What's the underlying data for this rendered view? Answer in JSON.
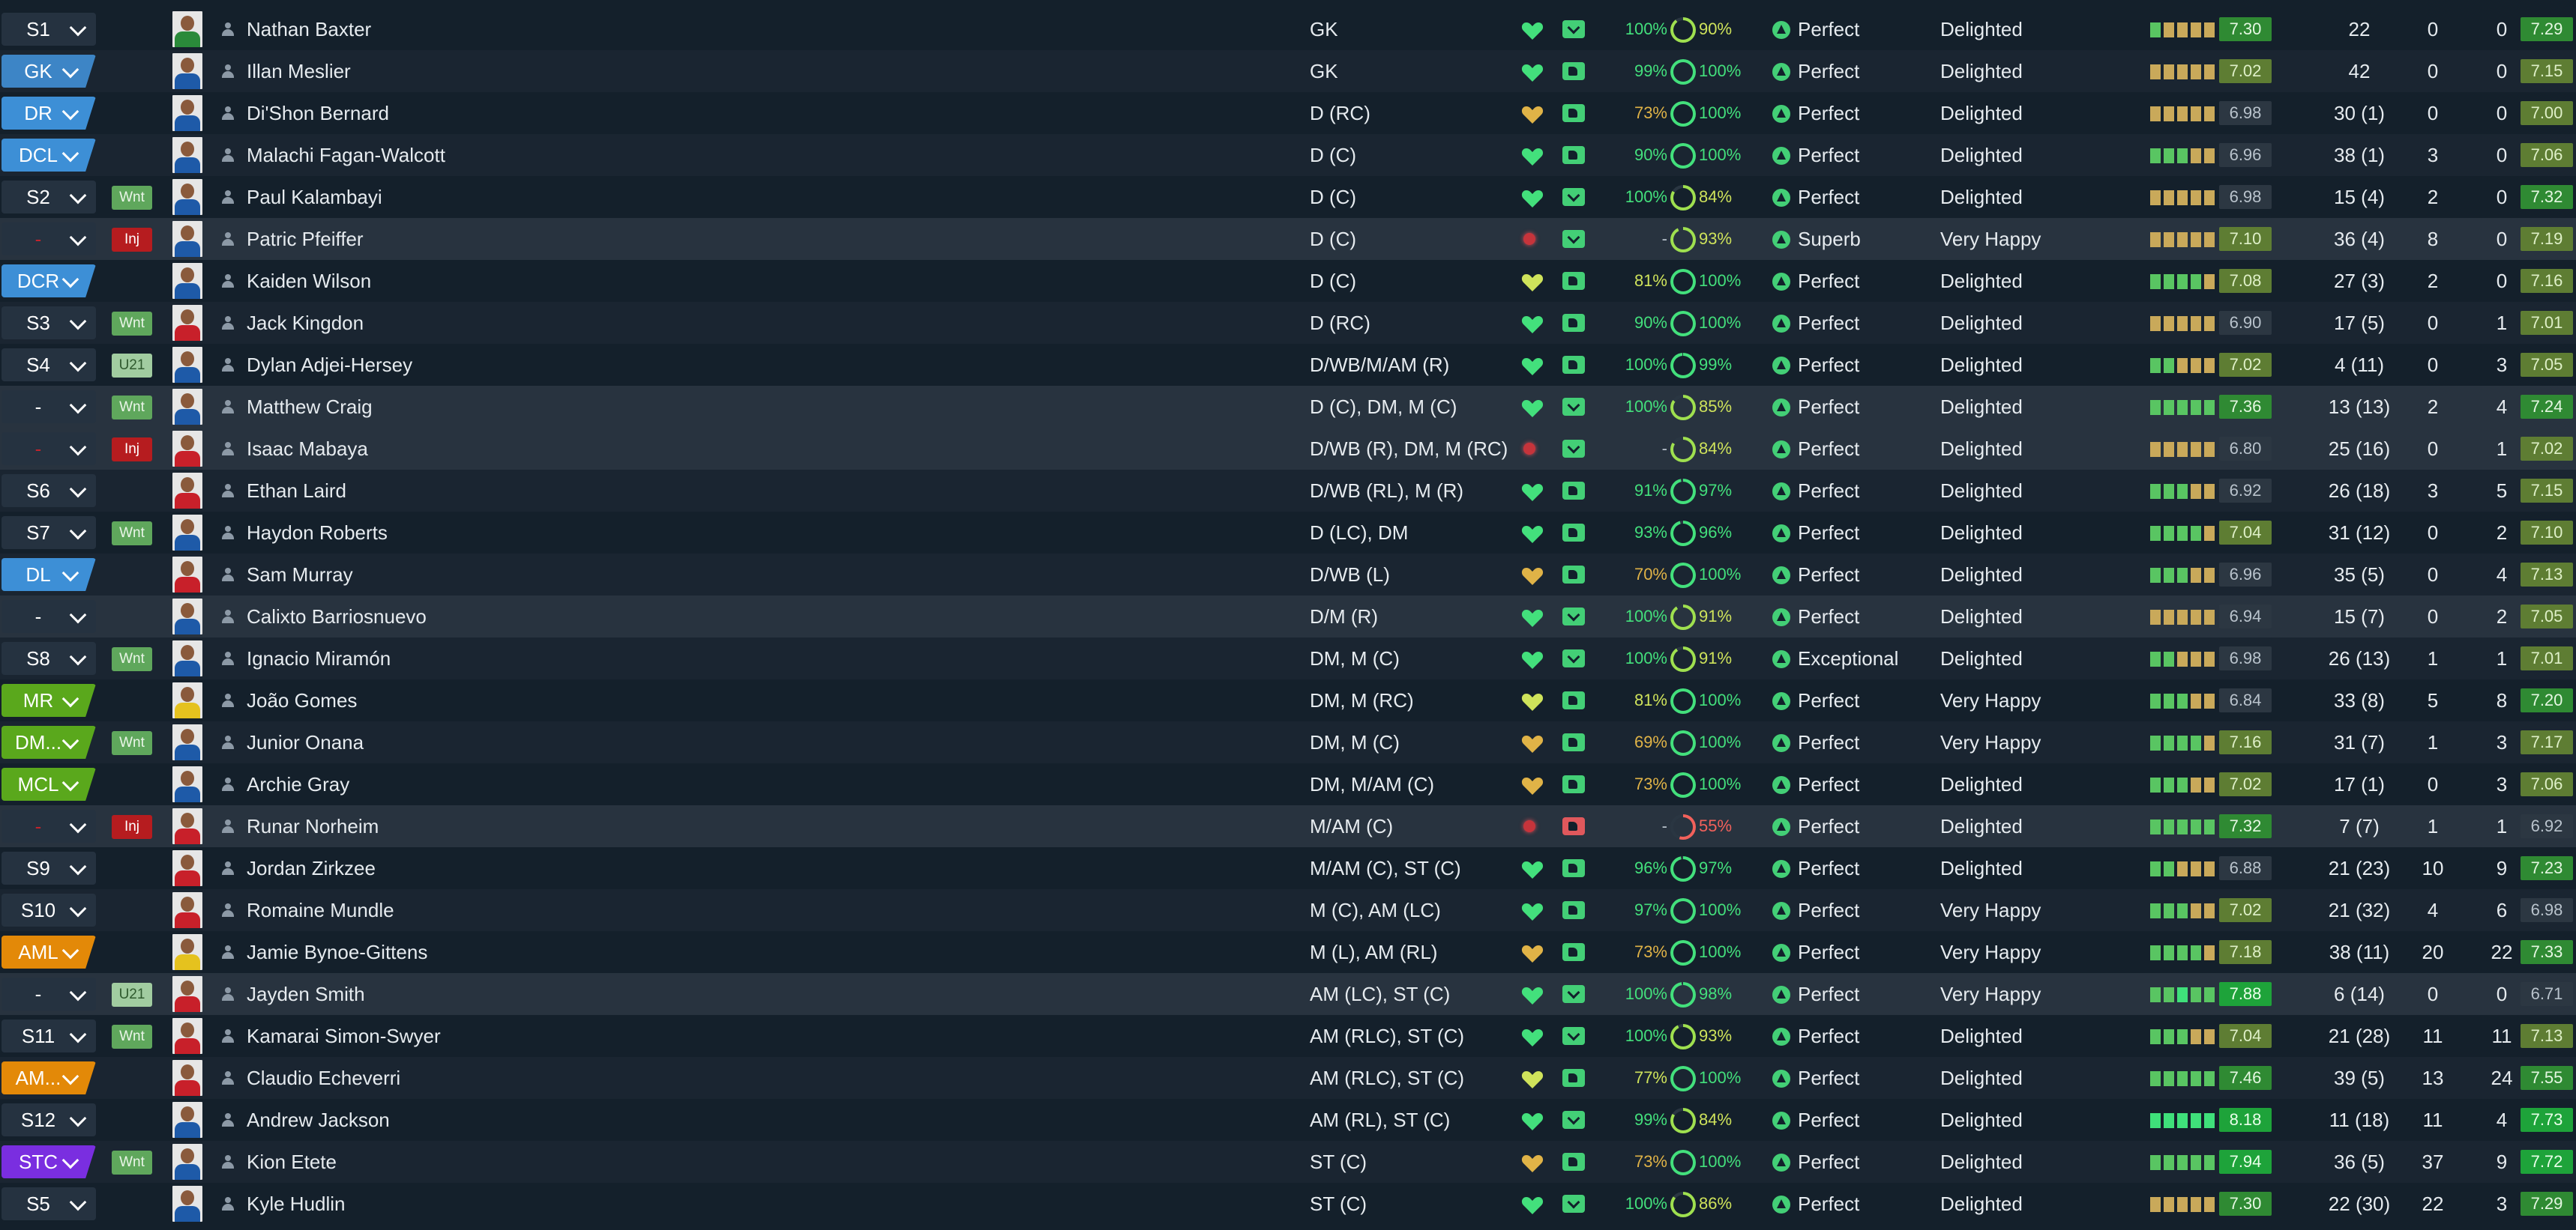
{
  "colors": {
    "pos_gk": "#3d85c6",
    "pos_def": "#3d8fd6",
    "pos_mid": "#5aa81c",
    "pos_att": "#e38908",
    "pos_st": "#7a2ee0",
    "good": "#43e07c",
    "caution": "#e0b347",
    "injury": "#c0242d"
  },
  "players": [
    {
      "sel": "S1",
      "sel_style": "plain",
      "tag": "",
      "tag_style": "",
      "kit": "green",
      "name": "Nathan Baxter",
      "position": "GK",
      "heart": "green",
      "fit": "check",
      "condition": "100%",
      "sharpness": "90%",
      "sharp_pct": 90,
      "morale_label": "Perfect",
      "happiness": "Delighted",
      "form": [
        3,
        2,
        2,
        2,
        2
      ],
      "rating": "7.30",
      "apps": "22",
      "goals": "0",
      "assists": "0",
      "avg": "7.29"
    },
    {
      "sel": "GK",
      "sel_style": "gk",
      "tag": "",
      "tag_style": "",
      "kit": "blue",
      "name": "Illan Meslier",
      "position": "GK",
      "heart": "green",
      "fit": "thumb",
      "condition": "99%",
      "sharpness": "100%",
      "sharp_pct": 100,
      "morale_label": "Perfect",
      "happiness": "Delighted",
      "form": [
        2,
        2,
        2,
        2,
        2
      ],
      "rating": "7.02",
      "apps": "42",
      "goals": "0",
      "assists": "0",
      "avg": "7.15"
    },
    {
      "sel": "DR",
      "sel_style": "def",
      "tag": "",
      "tag_style": "",
      "kit": "blue",
      "name": "Di'Shon Bernard",
      "position": "D (RC)",
      "heart": "amber",
      "fit": "thumb",
      "condition": "73%",
      "sharpness": "100%",
      "sharp_pct": 100,
      "morale_label": "Perfect",
      "happiness": "Delighted",
      "form": [
        2,
        2,
        2,
        2,
        2
      ],
      "rating": "6.98",
      "apps": "30 (1)",
      "goals": "0",
      "assists": "0",
      "avg": "7.00"
    },
    {
      "sel": "DCL",
      "sel_style": "def",
      "tag": "",
      "tag_style": "",
      "kit": "blue",
      "name": "Malachi Fagan-Walcott",
      "position": "D (C)",
      "heart": "green",
      "fit": "thumb",
      "condition": "90%",
      "sharpness": "100%",
      "sharp_pct": 100,
      "morale_label": "Perfect",
      "happiness": "Delighted",
      "form": [
        3,
        3,
        3,
        2,
        2
      ],
      "rating": "6.96",
      "apps": "38 (1)",
      "goals": "3",
      "assists": "0",
      "avg": "7.06"
    },
    {
      "sel": "S2",
      "sel_style": "plain",
      "tag": "Wnt",
      "tag_style": "wnt",
      "kit": "blue",
      "name": "Paul Kalambayi",
      "position": "D (C)",
      "heart": "green",
      "fit": "check",
      "condition": "100%",
      "sharpness": "84%",
      "sharp_pct": 84,
      "morale_label": "Perfect",
      "happiness": "Delighted",
      "form": [
        2,
        2,
        2,
        2,
        2
      ],
      "rating": "6.98",
      "apps": "15 (4)",
      "goals": "2",
      "assists": "0",
      "avg": "7.32"
    },
    {
      "sel": "-",
      "sel_style": "plain inj",
      "tag": "Inj",
      "tag_style": "inj",
      "kit": "blue",
      "name": "Patric Pfeiffer",
      "position": "D (C)",
      "heart": "injury",
      "fit": "check",
      "condition": "-",
      "sharpness": "93%",
      "sharp_pct": 93,
      "morale_label": "Superb",
      "happiness": "Very Happy",
      "form": [
        2,
        2,
        2,
        2,
        2
      ],
      "rating": "7.10",
      "apps": "36 (4)",
      "goals": "8",
      "assists": "0",
      "avg": "7.19"
    },
    {
      "sel": "DCR",
      "sel_style": "def",
      "tag": "",
      "tag_style": "",
      "kit": "blue",
      "name": "Kaiden Wilson",
      "position": "D (C)",
      "heart": "yellow",
      "fit": "thumb",
      "condition": "81%",
      "sharpness": "100%",
      "sharp_pct": 100,
      "morale_label": "Perfect",
      "happiness": "Delighted",
      "form": [
        3,
        3,
        3,
        3,
        2
      ],
      "rating": "7.08",
      "apps": "27 (3)",
      "goals": "2",
      "assists": "0",
      "avg": "7.16"
    },
    {
      "sel": "S3",
      "sel_style": "plain",
      "tag": "Wnt",
      "tag_style": "wnt",
      "kit": "red",
      "name": "Jack Kingdon",
      "position": "D (RC)",
      "heart": "green",
      "fit": "thumb",
      "condition": "90%",
      "sharpness": "100%",
      "sharp_pct": 100,
      "morale_label": "Perfect",
      "happiness": "Delighted",
      "form": [
        2,
        2,
        2,
        2,
        2
      ],
      "rating": "6.90",
      "apps": "17 (5)",
      "goals": "0",
      "assists": "1",
      "avg": "7.01"
    },
    {
      "sel": "S4",
      "sel_style": "plain",
      "tag": "U21",
      "tag_style": "u21",
      "kit": "blue",
      "name": "Dylan Adjei-Hersey",
      "position": "D/WB/M/AM (R)",
      "heart": "green",
      "fit": "thumb",
      "condition": "100%",
      "sharpness": "99%",
      "sharp_pct": 99,
      "morale_label": "Perfect",
      "happiness": "Delighted",
      "form": [
        3,
        3,
        2,
        2,
        2
      ],
      "rating": "7.02",
      "apps": "4 (11)",
      "goals": "0",
      "assists": "3",
      "avg": "7.05"
    },
    {
      "sel": "-",
      "sel_style": "plain",
      "tag": "Wnt",
      "tag_style": "wnt",
      "kit": "blue",
      "name": "Matthew Craig",
      "position": "D (C), DM, M (C)",
      "heart": "green",
      "fit": "check",
      "condition": "100%",
      "sharpness": "85%",
      "sharp_pct": 85,
      "morale_label": "Perfect",
      "happiness": "Delighted",
      "form": [
        3,
        3,
        3,
        3,
        3
      ],
      "rating": "7.36",
      "apps": "13 (13)",
      "goals": "2",
      "assists": "4",
      "avg": "7.24"
    },
    {
      "sel": "-",
      "sel_style": "plain inj",
      "tag": "Inj",
      "tag_style": "inj",
      "kit": "red",
      "name": "Isaac Mabaya",
      "position": "D/WB (R), DM, M (RC)",
      "heart": "injury",
      "fit": "check",
      "condition": "-",
      "sharpness": "84%",
      "sharp_pct": 84,
      "morale_label": "Perfect",
      "happiness": "Delighted",
      "form": [
        2,
        2,
        2,
        2,
        2
      ],
      "rating": "6.80",
      "apps": "25 (16)",
      "goals": "0",
      "assists": "1",
      "avg": "7.02"
    },
    {
      "sel": "S6",
      "sel_style": "plain",
      "tag": "",
      "tag_style": "",
      "kit": "red",
      "name": "Ethan Laird",
      "position": "D/WB (RL), M (R)",
      "heart": "green",
      "fit": "thumb",
      "condition": "91%",
      "sharpness": "97%",
      "sharp_pct": 97,
      "morale_label": "Perfect",
      "happiness": "Delighted",
      "form": [
        3,
        3,
        3,
        2,
        2
      ],
      "rating": "6.92",
      "apps": "26 (18)",
      "goals": "3",
      "assists": "5",
      "avg": "7.15"
    },
    {
      "sel": "S7",
      "sel_style": "plain",
      "tag": "Wnt",
      "tag_style": "wnt",
      "kit": "blue",
      "name": "Haydon Roberts",
      "position": "D (LC), DM",
      "heart": "green",
      "fit": "thumb",
      "condition": "93%",
      "sharpness": "96%",
      "sharp_pct": 96,
      "morale_label": "Perfect",
      "happiness": "Delighted",
      "form": [
        3,
        3,
        3,
        3,
        2
      ],
      "rating": "7.04",
      "apps": "31 (12)",
      "goals": "0",
      "assists": "2",
      "avg": "7.10"
    },
    {
      "sel": "DL",
      "sel_style": "def",
      "tag": "",
      "tag_style": "",
      "kit": "red",
      "name": "Sam Murray",
      "position": "D/WB (L)",
      "heart": "amber",
      "fit": "thumb",
      "condition": "70%",
      "sharpness": "100%",
      "sharp_pct": 100,
      "morale_label": "Perfect",
      "happiness": "Delighted",
      "form": [
        3,
        3,
        3,
        2,
        2
      ],
      "rating": "6.96",
      "apps": "35 (5)",
      "goals": "0",
      "assists": "4",
      "avg": "7.13"
    },
    {
      "sel": "-",
      "sel_style": "plain",
      "tag": "",
      "tag_style": "",
      "kit": "blue",
      "name": "Calixto Barriosnuevo",
      "position": "D/M (R)",
      "heart": "green",
      "fit": "check",
      "condition": "100%",
      "sharpness": "91%",
      "sharp_pct": 91,
      "morale_label": "Perfect",
      "happiness": "Delighted",
      "form": [
        2,
        2,
        2,
        2,
        2
      ],
      "rating": "6.94",
      "apps": "15 (7)",
      "goals": "0",
      "assists": "2",
      "avg": "7.05"
    },
    {
      "sel": "S8",
      "sel_style": "plain",
      "tag": "Wnt",
      "tag_style": "wnt",
      "kit": "blue",
      "name": "Ignacio Miramón",
      "position": "DM, M (C)",
      "heart": "green",
      "fit": "check",
      "condition": "100%",
      "sharpness": "91%",
      "sharp_pct": 91,
      "morale_label": "Exceptional",
      "happiness": "Delighted",
      "form": [
        3,
        3,
        2,
        2,
        2
      ],
      "rating": "6.98",
      "apps": "26 (13)",
      "goals": "1",
      "assists": "1",
      "avg": "7.01"
    },
    {
      "sel": "MR",
      "sel_style": "mid",
      "tag": "",
      "tag_style": "",
      "kit": "yellow",
      "name": "João Gomes",
      "position": "DM, M (RC)",
      "heart": "yellow",
      "fit": "thumb",
      "condition": "81%",
      "sharpness": "100%",
      "sharp_pct": 100,
      "morale_label": "Perfect",
      "happiness": "Very Happy",
      "form": [
        3,
        3,
        3,
        2,
        2
      ],
      "rating": "6.84",
      "apps": "33 (8)",
      "goals": "5",
      "assists": "8",
      "avg": "7.20"
    },
    {
      "sel": "DM...",
      "sel_style": "mid",
      "tag": "Wnt",
      "tag_style": "wnt",
      "kit": "blue",
      "name": "Junior Onana",
      "position": "DM, M (C)",
      "heart": "amber",
      "fit": "thumb",
      "condition": "69%",
      "sharpness": "100%",
      "sharp_pct": 100,
      "morale_label": "Perfect",
      "happiness": "Very Happy",
      "form": [
        3,
        3,
        3,
        3,
        2
      ],
      "rating": "7.16",
      "apps": "31 (7)",
      "goals": "1",
      "assists": "3",
      "avg": "7.17"
    },
    {
      "sel": "MCL",
      "sel_style": "mid",
      "tag": "",
      "tag_style": "",
      "kit": "blue",
      "name": "Archie Gray",
      "position": "DM, M/AM (C)",
      "heart": "amber",
      "fit": "thumb",
      "condition": "73%",
      "sharpness": "100%",
      "sharp_pct": 100,
      "morale_label": "Perfect",
      "happiness": "Delighted",
      "form": [
        3,
        3,
        3,
        2,
        2
      ],
      "rating": "7.02",
      "apps": "17 (1)",
      "goals": "0",
      "assists": "3",
      "avg": "7.06"
    },
    {
      "sel": "-",
      "sel_style": "plain inj",
      "tag": "Inj",
      "tag_style": "inj",
      "kit": "red",
      "name": "Runar Norheim",
      "position": "M/AM (C)",
      "heart": "injury",
      "fit": "thumbred",
      "condition": "-",
      "sharpness": "55%",
      "sharp_pct": 55,
      "morale_label": "Perfect",
      "happiness": "Delighted",
      "form": [
        3,
        3,
        3,
        3,
        3
      ],
      "rating": "7.32",
      "apps": "7 (7)",
      "goals": "1",
      "assists": "1",
      "avg": "6.92"
    },
    {
      "sel": "S9",
      "sel_style": "plain",
      "tag": "",
      "tag_style": "",
      "kit": "red",
      "name": "Jordan Zirkzee",
      "position": "M/AM (C), ST (C)",
      "heart": "green",
      "fit": "thumb",
      "condition": "96%",
      "sharpness": "97%",
      "sharp_pct": 97,
      "morale_label": "Perfect",
      "happiness": "Delighted",
      "form": [
        3,
        3,
        2,
        2,
        2
      ],
      "rating": "6.88",
      "apps": "21 (23)",
      "goals": "10",
      "assists": "9",
      "avg": "7.23"
    },
    {
      "sel": "S10",
      "sel_style": "plain",
      "tag": "",
      "tag_style": "",
      "kit": "red",
      "name": "Romaine Mundle",
      "position": "M (C), AM (LC)",
      "heart": "green",
      "fit": "thumb",
      "condition": "97%",
      "sharpness": "100%",
      "sharp_pct": 100,
      "morale_label": "Perfect",
      "happiness": "Very Happy",
      "form": [
        3,
        3,
        3,
        2,
        2
      ],
      "rating": "7.02",
      "apps": "21 (32)",
      "goals": "4",
      "assists": "6",
      "avg": "6.98"
    },
    {
      "sel": "AML",
      "sel_style": "att",
      "tag": "",
      "tag_style": "",
      "kit": "yellow",
      "name": "Jamie Bynoe-Gittens",
      "position": "M (L), AM (RL)",
      "heart": "amber",
      "fit": "thumb",
      "condition": "73%",
      "sharpness": "100%",
      "sharp_pct": 100,
      "morale_label": "Perfect",
      "happiness": "Very Happy",
      "form": [
        3,
        3,
        3,
        3,
        2
      ],
      "rating": "7.18",
      "apps": "38 (11)",
      "goals": "20",
      "assists": "22",
      "avg": "7.33"
    },
    {
      "sel": "-",
      "sel_style": "plain",
      "tag": "U21",
      "tag_style": "u21",
      "kit": "red",
      "name": "Jayden Smith",
      "position": "AM (LC), ST (C)",
      "heart": "green",
      "fit": "check",
      "condition": "100%",
      "sharpness": "98%",
      "sharp_pct": 98,
      "morale_label": "Perfect",
      "happiness": "Very Happy",
      "form": [
        3,
        3,
        1,
        3,
        3
      ],
      "rating": "7.88",
      "apps": "6 (14)",
      "goals": "0",
      "assists": "0",
      "avg": "6.71"
    },
    {
      "sel": "S11",
      "sel_style": "plain",
      "tag": "Wnt",
      "tag_style": "wnt",
      "kit": "red",
      "name": "Kamarai Simon-Swyer",
      "position": "AM (RLC), ST (C)",
      "heart": "green",
      "fit": "check",
      "condition": "100%",
      "sharpness": "93%",
      "sharp_pct": 93,
      "morale_label": "Perfect",
      "happiness": "Delighted",
      "form": [
        3,
        3,
        3,
        2,
        2
      ],
      "rating": "7.04",
      "apps": "21 (28)",
      "goals": "11",
      "assists": "11",
      "avg": "7.13"
    },
    {
      "sel": "AM...",
      "sel_style": "att",
      "tag": "",
      "tag_style": "",
      "kit": "red",
      "name": "Claudio Echeverri",
      "position": "AM (RLC), ST (C)",
      "heart": "yellow",
      "fit": "thumb",
      "condition": "77%",
      "sharpness": "100%",
      "sharp_pct": 100,
      "morale_label": "Perfect",
      "happiness": "Delighted",
      "form": [
        3,
        3,
        3,
        3,
        3
      ],
      "rating": "7.46",
      "apps": "39 (5)",
      "goals": "13",
      "assists": "24",
      "avg": "7.55"
    },
    {
      "sel": "S12",
      "sel_style": "plain",
      "tag": "",
      "tag_style": "",
      "kit": "blue",
      "name": "Andrew Jackson",
      "position": "AM (RL), ST (C)",
      "heart": "green",
      "fit": "check",
      "condition": "99%",
      "sharpness": "84%",
      "sharp_pct": 84,
      "morale_label": "Perfect",
      "happiness": "Delighted",
      "form": [
        1,
        1,
        1,
        1,
        1
      ],
      "rating": "8.18",
      "apps": "11 (18)",
      "goals": "11",
      "assists": "4",
      "avg": "7.73"
    },
    {
      "sel": "STC",
      "sel_style": "st",
      "tag": "Wnt",
      "tag_style": "wnt",
      "kit": "blue",
      "name": "Kion Etete",
      "position": "ST (C)",
      "heart": "amber",
      "fit": "thumb",
      "condition": "73%",
      "sharpness": "100%",
      "sharp_pct": 100,
      "morale_label": "Perfect",
      "happiness": "Delighted",
      "form": [
        3,
        3,
        3,
        3,
        3
      ],
      "rating": "7.94",
      "apps": "36 (5)",
      "goals": "37",
      "assists": "9",
      "avg": "7.72"
    },
    {
      "sel": "S5",
      "sel_style": "plain",
      "tag": "",
      "tag_style": "",
      "kit": "blue",
      "name": "Kyle Hudlin",
      "position": "ST (C)",
      "heart": "green",
      "fit": "check",
      "condition": "100%",
      "sharpness": "86%",
      "sharp_pct": 86,
      "morale_label": "Perfect",
      "happiness": "Delighted",
      "form": [
        2,
        2,
        2,
        2,
        2
      ],
      "rating": "7.30",
      "apps": "22 (30)",
      "goals": "22",
      "assists": "3",
      "avg": "7.29"
    }
  ]
}
